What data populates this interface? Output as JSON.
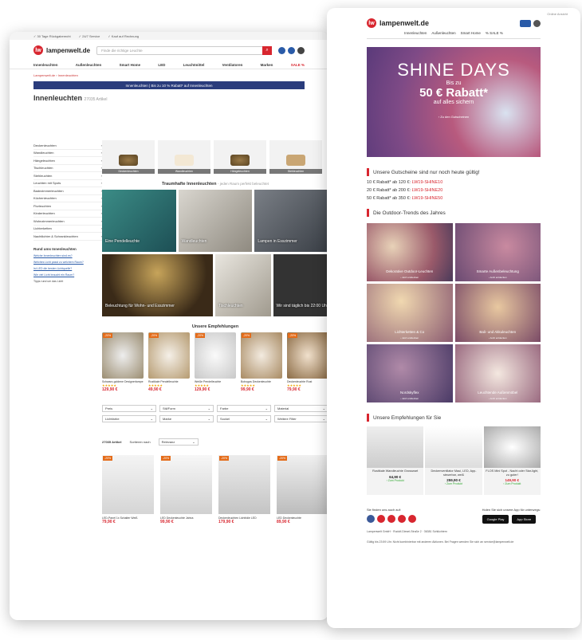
{
  "left": {
    "topbar": [
      "✓ 30 Tage Rückgaberecht",
      "✓ 24/7 Service",
      "✓ Kauf auf Rechnung"
    ],
    "logo": "lampenwelt.de",
    "search_placeholder": "Finde die richtige Leuchte",
    "nav": [
      "Innenleuchten",
      "Außenleuchten",
      "Smart Home",
      "LED",
      "Leuchtmittel",
      "Ventilatoren",
      "Marken",
      "SALE %"
    ],
    "breadcrumb": "Lampenwelt.de › Innenleuchten",
    "promo": "Innenleuchten | Bis zu 10 % Rabatt* auf Innenleuchten",
    "title": "Innenleuchten",
    "count": "27035 Artikel",
    "side": [
      "Deckenleuchten",
      "Wandleuchten",
      "Hängeleuchten",
      "Tischleuchten",
      "Stehleuchten",
      "Leuchten mit Spots",
      "Badezimmerleuchten",
      "Küchenleuchten",
      "Flurleuchten",
      "Kinderleuchten",
      "Wohnzimmerleuchten",
      "Lichterketten",
      "Nachtlichter & Schrankleuchten"
    ],
    "side_heading": "Rund ums Innenleuchten",
    "side_links": [
      "Welche Innenleuchten sind es?",
      "Welches Licht passt zu welchem Raum?",
      "Ist LED die besten Lichtquelle?",
      "Wie viel Licht braucht ein Raum?"
    ],
    "side_text": "Tipps rund um das Licht",
    "categories": [
      "Deckenleuchten",
      "Wandleuchten",
      "Hängeleuchten",
      "Stehleuchten"
    ],
    "dream_title": "Traumhafte Innenleuchten",
    "dream_sub": "- jeden Raum perfekt beleuchtet",
    "tiles": [
      "Eine Pendelleuchte",
      "Wandleuchten",
      "Lampen in Esszimmer",
      "Beleuchtung für Wohn- und Esszimmer",
      "Tischleuchten",
      "Wir sind täglich bis 22:00 Uhr"
    ],
    "recos_title": "Unsere Empfehlungen",
    "recos": [
      {
        "name": "Schwarz-goldene Designerlampe",
        "price": "129,90 €",
        "badge": "-20%"
      },
      {
        "name": "Rustikale Pendelleuchte",
        "price": "49,90 €",
        "badge": "-20%"
      },
      {
        "name": "Weiße Pendelleuchte",
        "price": "129,90 €",
        "badge": "-20%"
      },
      {
        "name": "Bohogas Deckenleuchte",
        "price": "99,90 €",
        "badge": "-20%"
      },
      {
        "name": "Deckenleuchte Rust",
        "price": "79,90 €",
        "badge": "-20%"
      }
    ],
    "filters": [
      "Preis",
      "Stil/Form",
      "Farbe",
      "Material",
      "Lichtfarbe",
      "Marke",
      "Sockel",
      "Weitere Filter"
    ],
    "sort_count": "27035 Artikel",
    "sort_label": "Sortieren nach",
    "sort_value": "Relevanz",
    "products": [
      {
        "name": "LED-Panel 1x Schalter Weiß",
        "price": "79,90 €"
      },
      {
        "name": "LED Deckenleuchte Jahna",
        "price": "99,90 €"
      },
      {
        "name": "Deckenleuchten Lichtfolie LED",
        "price": "179,90 €"
      },
      {
        "name": "LED Deckenleuchte",
        "price": "89,90 €"
      }
    ]
  },
  "right": {
    "topbar": "Online Ansicht",
    "logo": "lampenwelt.de",
    "nav": [
      "Innenleuchten",
      "Außenleuchten",
      "Smart Home",
      "% SALE %"
    ],
    "hero": {
      "title": "SHINE DAYS",
      "line1": "Bis zu",
      "discount": "50 € Rabatt*",
      "line2": "auf alles sichern",
      "cta": "› Zu den Gutscheinen"
    },
    "vouchers_title": "Unsere Gutscheine sind nur noch heute gültig!",
    "codes": [
      {
        "text": "10 € Rabatt* ab 120 €:",
        "code": "LW19-SHINE10"
      },
      {
        "text": "20 € Rabatt* ab 200 €:",
        "code": "LW19-SHINE20"
      },
      {
        "text": "50 € Rabatt* ab 350 €:",
        "code": "LW19-SHINE50"
      }
    ],
    "outdoor_title": "Die Outdoor-Trends des Jahres",
    "outdoor": [
      {
        "label": "Dekorative Outdoor-Leuchten",
        "sub": "› Jetzt entdecken"
      },
      {
        "label": "Smarte Außenbeleuchtung",
        "sub": "› Jetzt entdecken"
      },
      {
        "label": "Lichterketten & Co",
        "sub": "› Jetzt entdecken"
      },
      {
        "label": "Bali- und Akkuleuchten",
        "sub": "› Jetzt entdecken"
      },
      {
        "label": "Nordskyflex",
        "sub": "› Jetzt entdecken"
      },
      {
        "label": "Leuchtende Außenmöbel",
        "sub": "› Jetzt entdecken"
      }
    ],
    "emp_title": "Unsere Empfehlungen für Sie",
    "emp": [
      {
        "name": "Rustikale Wandleuchte Grosswart",
        "price": "64,90 €",
        "stock": "› Zum Produkt"
      },
      {
        "name": "Deckenventilator Maui, LED, App-steuerbar, weiß",
        "price": "259,90 €",
        "stock": "› Zum Produkt"
      },
      {
        "name": "FLOS Mini Spot - Nacht oder Star-light, zu guter!",
        "price": "149,90 €",
        "stock": "› Zum Produkt"
      }
    ],
    "social_title": "Sie finden uns auch auf:",
    "app_title": "Holen Sie sich unsere App für unterwegs:",
    "stores": [
      "Google Play",
      "App Store"
    ],
    "address": "Lampenwelt GmbH · Rudolf-Diesel-Straße 2 · 36381 Schlüchtern",
    "legal": "Gültig bis 23:59 Uhr. Nicht kombinierbar mit anderen Aktionen. Bei Fragen wenden Sie sich an service@lampenwelt.de"
  }
}
